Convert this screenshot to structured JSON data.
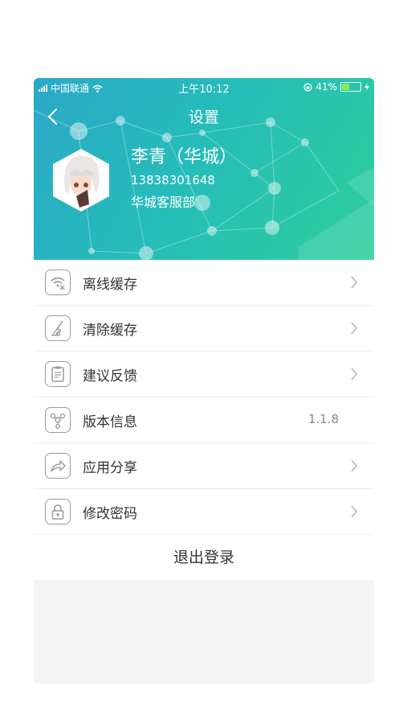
{
  "status_bar": {
    "carrier": "中国联通",
    "time": "上午10:12",
    "battery": "41%",
    "battery_level": 0.41
  },
  "nav": {
    "title": "设置"
  },
  "profile": {
    "name": "李青（华城）",
    "phone": "13838301648",
    "department": "华城客服部"
  },
  "menu": [
    {
      "label": "离线缓存",
      "icon": "offline-cache-icon"
    },
    {
      "label": "清除缓存",
      "icon": "broom-icon"
    },
    {
      "label": "建议反馈",
      "icon": "feedback-icon"
    },
    {
      "label": "版本信息",
      "icon": "version-share-nodes-icon",
      "value": "1.1.8"
    },
    {
      "label": "应用分享",
      "icon": "share-arrow-icon"
    },
    {
      "label": "修改密码",
      "icon": "lock-icon"
    }
  ],
  "logout_label": "退出登录",
  "colors": {
    "header_start": "#2ba8c9",
    "header_end": "#2ecf9c",
    "battery": "#7cf25a"
  }
}
